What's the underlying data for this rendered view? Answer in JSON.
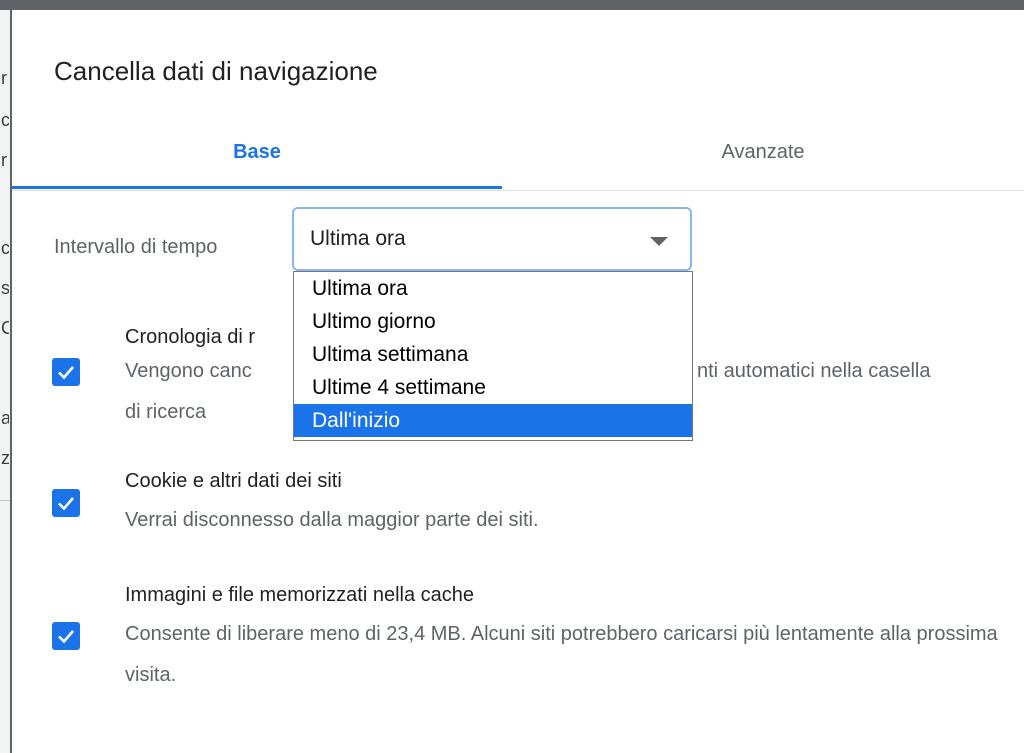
{
  "dialog": {
    "title": "Cancella dati di navigazione",
    "tabs": [
      {
        "label": "Base",
        "active": true
      },
      {
        "label": "Avanzate",
        "active": false
      }
    ]
  },
  "time_range": {
    "label": "Intervallo di tempo",
    "selected": "Ultima ora",
    "options": [
      "Ultima ora",
      "Ultimo giorno",
      "Ultima settimana",
      "Ultime 4 settimane",
      "Dall'inizio"
    ],
    "highlighted_option": "Dall'inizio"
  },
  "items": [
    {
      "title": "Cronologia di r",
      "description_start": "Vengono canc",
      "description_end": "nti automatici nella casella",
      "description_line2": "di ricerca",
      "checked": true
    },
    {
      "title": "Cookie e altri dati dei siti",
      "description": "Verrai disconnesso dalla maggior parte dei siti.",
      "checked": true
    },
    {
      "title": "Immagini e file memorizzati nella cache",
      "description": "Consente di liberare meno di 23,4 MB. Alcuni siti potrebbero caricarsi più lentamente alla prossima visita.",
      "checked": true
    }
  ],
  "colors": {
    "accent": "#1a73e8",
    "text_primary": "#202124",
    "text_secondary": "#5f6368",
    "focus_border": "#8ab4f8"
  },
  "background_fragments": [
    "r",
    "c",
    "r",
    "c",
    "s",
    "C",
    "a",
    "z"
  ]
}
